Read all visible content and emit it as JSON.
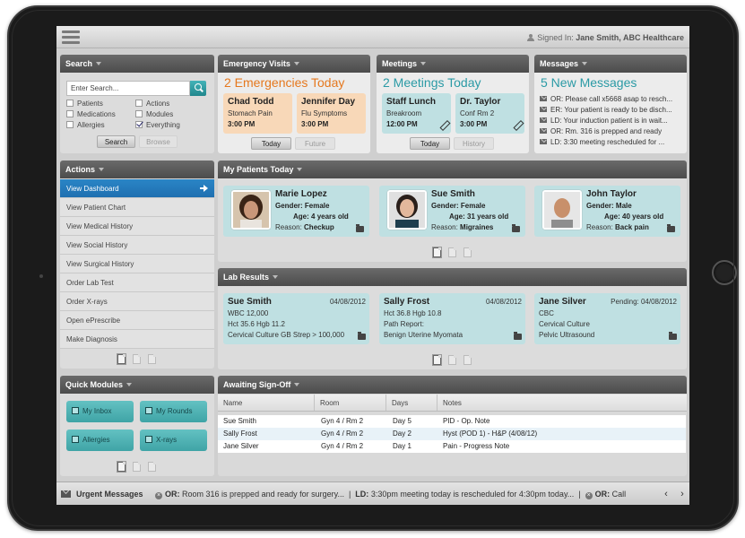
{
  "header": {
    "signed_in": "Signed In:",
    "user": "Jane Smith, ABC Healthcare"
  },
  "search": {
    "title": "Search",
    "placeholder": "Enter Search...",
    "filters": [
      {
        "label": "Patients",
        "checked": false
      },
      {
        "label": "Actions",
        "checked": false
      },
      {
        "label": "Medications",
        "checked": false
      },
      {
        "label": "Modules",
        "checked": false
      },
      {
        "label": "Allergies",
        "checked": false
      },
      {
        "label": "Everything",
        "checked": true
      }
    ],
    "search_btn": "Search",
    "browse_btn": "Browse"
  },
  "emergency": {
    "title": "Emergency Visits",
    "headline": "2 Emergencies Today",
    "cards": [
      {
        "name": "Chad Todd",
        "reason": "Stomach Pain",
        "time": "3:00 PM"
      },
      {
        "name": "Jennifer Day",
        "reason": "Flu Symptoms",
        "time": "3:00 PM"
      }
    ],
    "today": "Today",
    "future": "Future"
  },
  "meetings": {
    "title": "Meetings",
    "headline": "2 Meetings Today",
    "cards": [
      {
        "name": "Staff Lunch",
        "place": "Breakroom",
        "time": "12:00 PM"
      },
      {
        "name": "Dr. Taylor",
        "place": "Conf Rm 2",
        "time": "3:00 PM"
      }
    ],
    "today": "Today",
    "history": "History"
  },
  "messages": {
    "title": "Messages",
    "headline": "5 New Messages",
    "items": [
      "OR: Please call x5668 asap to resch...",
      "ER: Your patient is ready to be disch...",
      "LD: Your induction patient is in wait...",
      "OR: Rm. 316 is prepped and ready",
      "LD: 3:30 meeting rescheduled for ..."
    ]
  },
  "actions": {
    "title": "Actions",
    "items": [
      "View Dashboard",
      "View Patient Chart",
      "View Medical History",
      "View Social History",
      "View Surgical History",
      "Order Lab Test",
      "Order X-rays",
      "Open ePrescribe",
      "Make Diagnosis"
    ]
  },
  "patients": {
    "title": "My Patients Today",
    "gender_label": "Gender:",
    "age_label": "Age:",
    "reason_label": "Reason:",
    "cards": [
      {
        "name": "Marie Lopez",
        "gender": "Female",
        "age": "4 years old",
        "reason": "Checkup"
      },
      {
        "name": "Sue Smith",
        "gender": "Female",
        "age": "31 years old",
        "reason": "Migraines"
      },
      {
        "name": "John Taylor",
        "gender": "Male",
        "age": "40 years old",
        "reason": "Back pain"
      }
    ]
  },
  "labs": {
    "title": "Lab Results",
    "cards": [
      {
        "name": "Sue Smith",
        "date": "04/08/2012",
        "l1": "WBC 12,000",
        "l2": "Hct 35.6 Hgb 11.2",
        "l3": "Cervical Culture GB Strep > 100,000"
      },
      {
        "name": "Sally Frost",
        "date": "04/08/2012",
        "l1": "Hct 36.8 Hgb 10.8",
        "l2": "Path Report:",
        "l3": "Benign Uterine Myomata"
      },
      {
        "name": "Jane Silver",
        "date": "Pending: 04/08/2012",
        "l1": "CBC",
        "l2": "Cervical Culture",
        "l3": "Pelvic Ultrasound"
      }
    ]
  },
  "quick": {
    "title": "Quick Modules",
    "items": [
      "My Inbox",
      "My Rounds",
      "Allergies",
      "X-rays"
    ]
  },
  "signoff": {
    "title": "Awaiting Sign-Off",
    "columns": [
      "Name",
      "Room",
      "Days",
      "Notes"
    ],
    "rows": [
      [
        "Sue Smith",
        "Gyn 4 / Rm 2",
        "Day 5",
        "PID - Op. Note"
      ],
      [
        "Sally Frost",
        "Gyn 4 / Rm 2",
        "Day 2",
        "Hyst (POD 1) - H&P (4/08/12)"
      ],
      [
        "Jane Silver",
        "Gyn 4 / Rm 2",
        "Day 1",
        "Pain - Progress Note"
      ]
    ]
  },
  "urgent": {
    "title": "Urgent Messages",
    "ticker": [
      {
        "tag": "OR:",
        "text": "Room 316 is prepped and ready for surgery..."
      },
      {
        "tag": "LD:",
        "text": "3:30pm meeting today is rescheduled for 4:30pm today..."
      },
      {
        "tag": "OR:",
        "text": "Call"
      }
    ]
  }
}
